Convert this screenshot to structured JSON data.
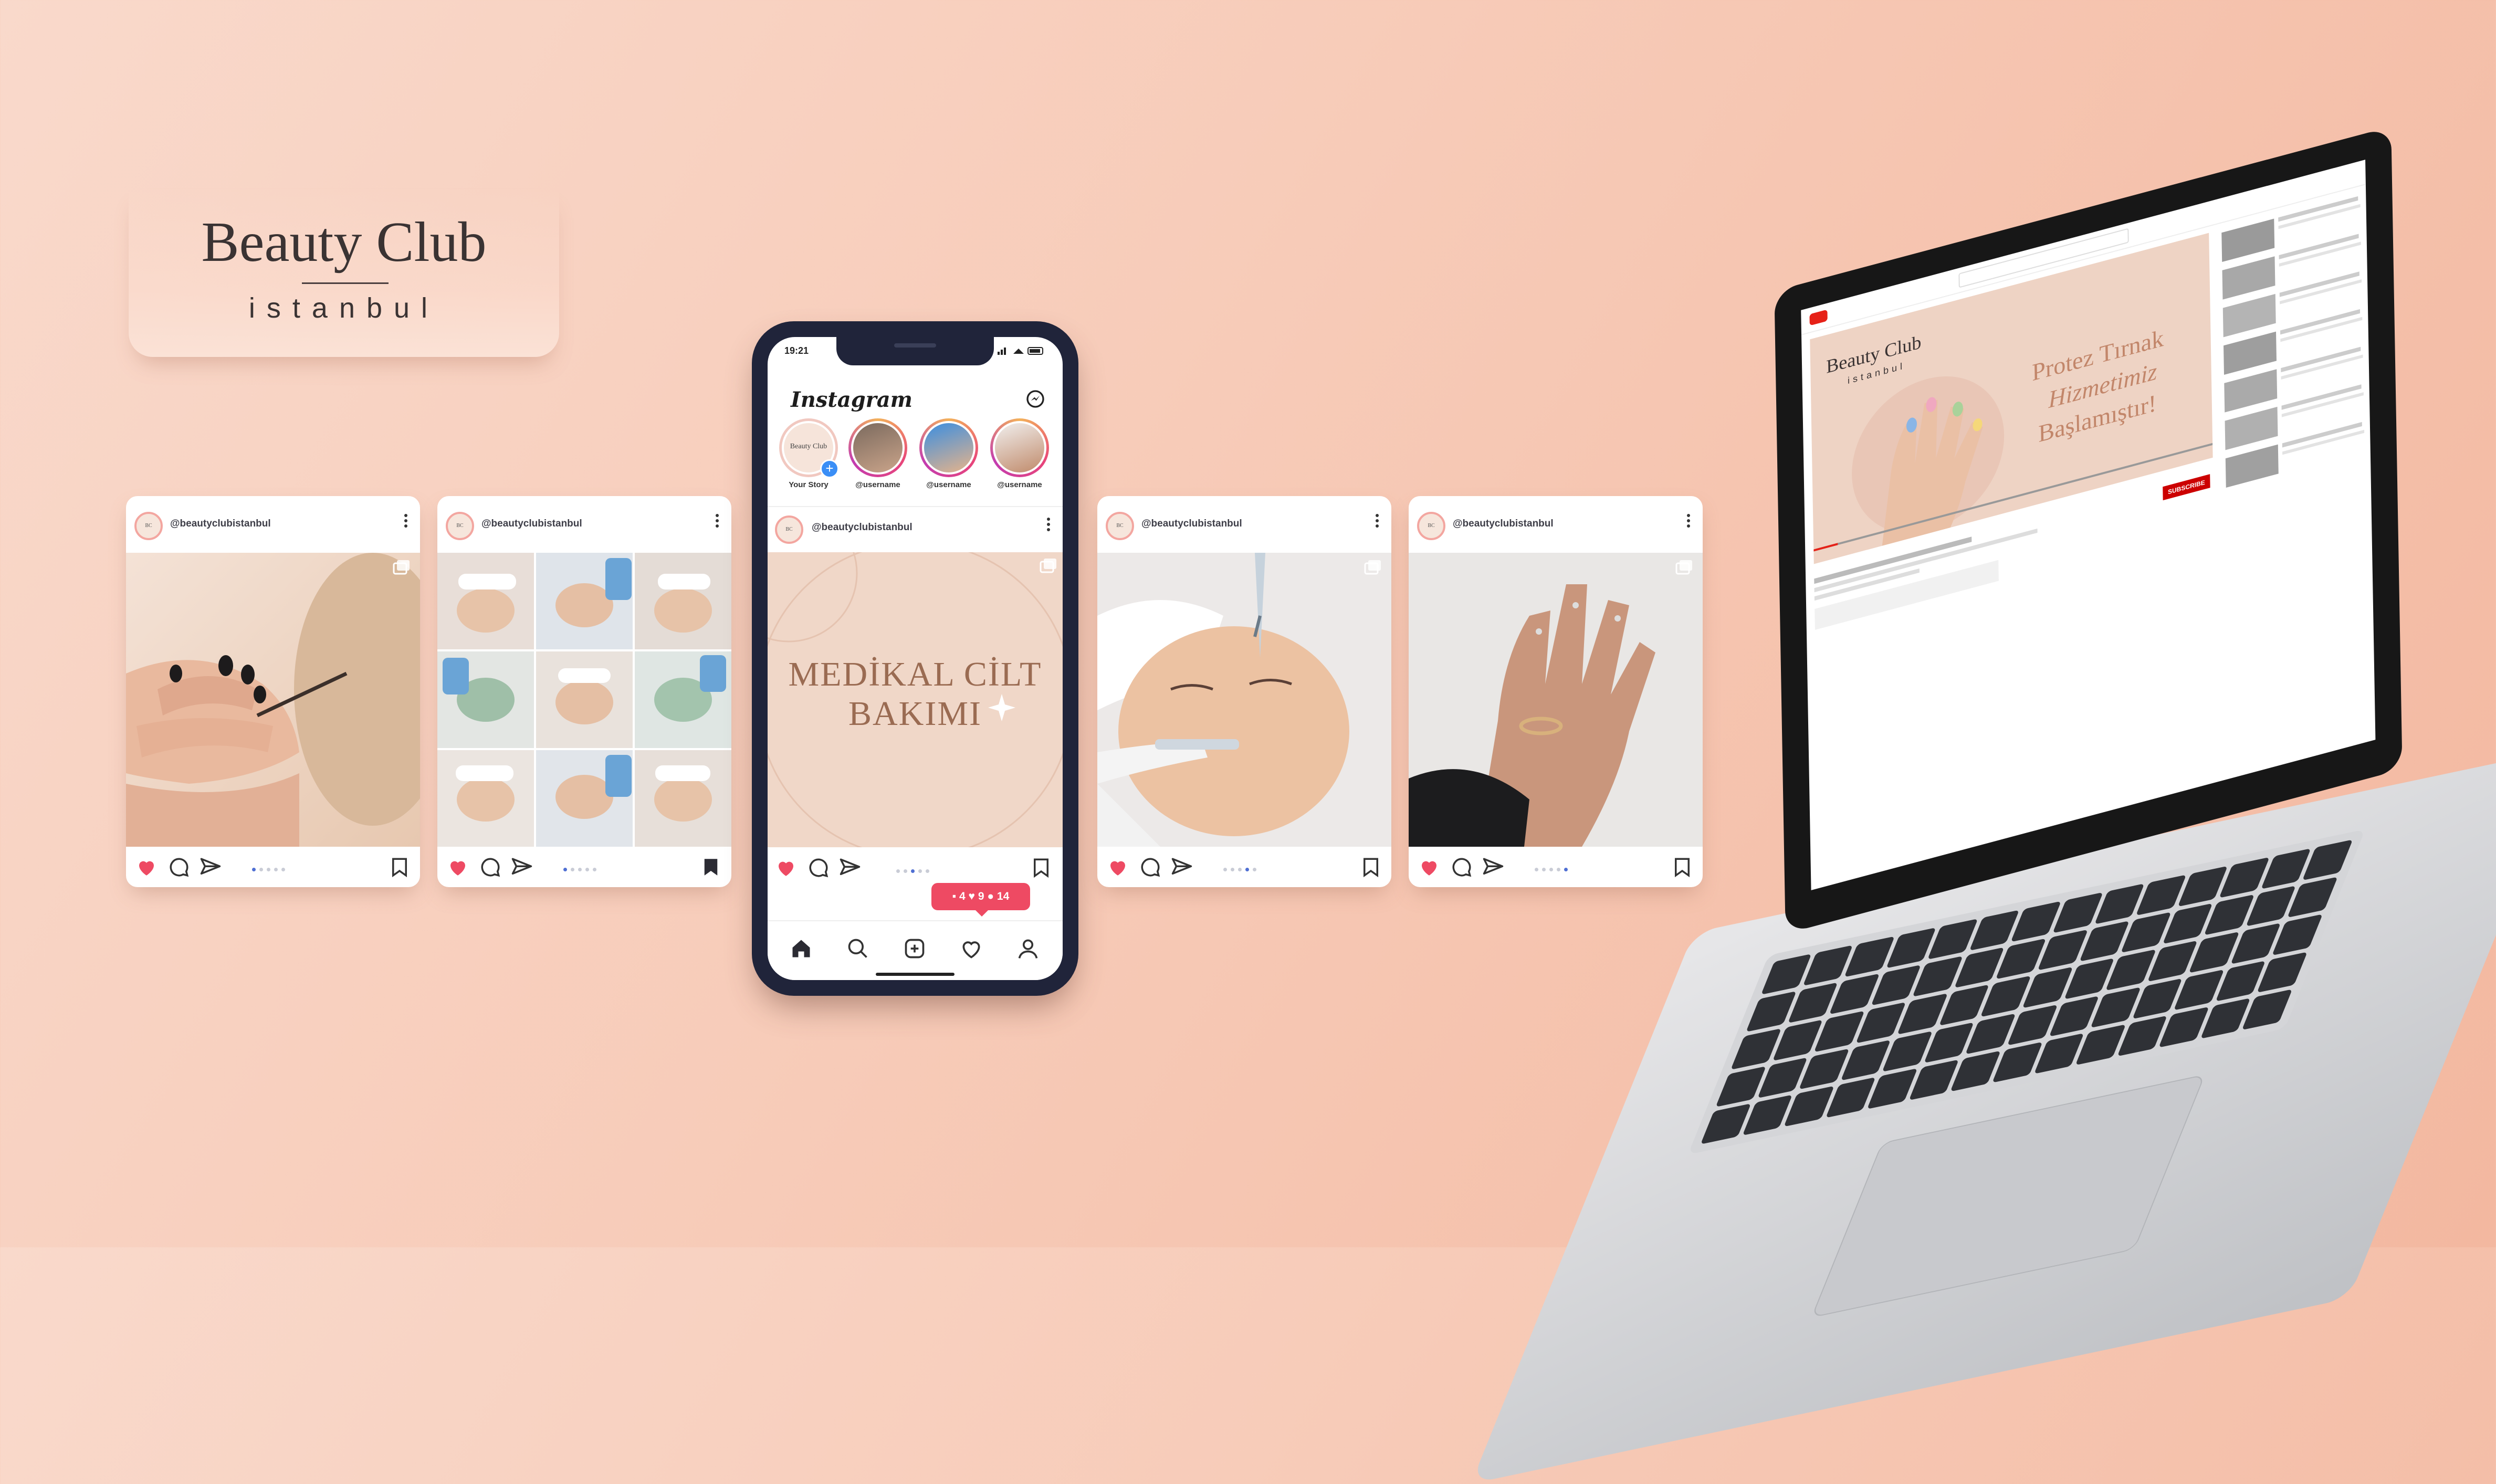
{
  "brand": {
    "name": "Beauty Club",
    "city": "istanbul"
  },
  "posts": {
    "handle": "@beautyclubistanbul"
  },
  "phone": {
    "time": "19:21",
    "app_name": "Instagram",
    "stories": [
      {
        "label": "Your Story"
      },
      {
        "label": "@username"
      },
      {
        "label": "@username"
      },
      {
        "label": "@username"
      }
    ],
    "post_handle": "@beautyclubistanbul",
    "post_headline_line1": "MEDİKAL CİLT",
    "post_headline_line2": "BAKIMI",
    "notification": {
      "comments": "4",
      "likes": "9",
      "followers": "14"
    }
  },
  "laptop": {
    "video_overlay_line1": "Protez Tırnak",
    "video_overlay_line2": "Hizmetimiz",
    "video_overlay_line3": "Başlamıştır!",
    "video_brand": "Beauty Club",
    "video_brand_sub": "istanbul",
    "subscribe_label": "SUBSCRIBE"
  },
  "colors": {
    "background": "#f7cbb8",
    "like": "#ee4a63",
    "accent_blue": "#4f6fd3",
    "phone_frame": "#20243a"
  }
}
